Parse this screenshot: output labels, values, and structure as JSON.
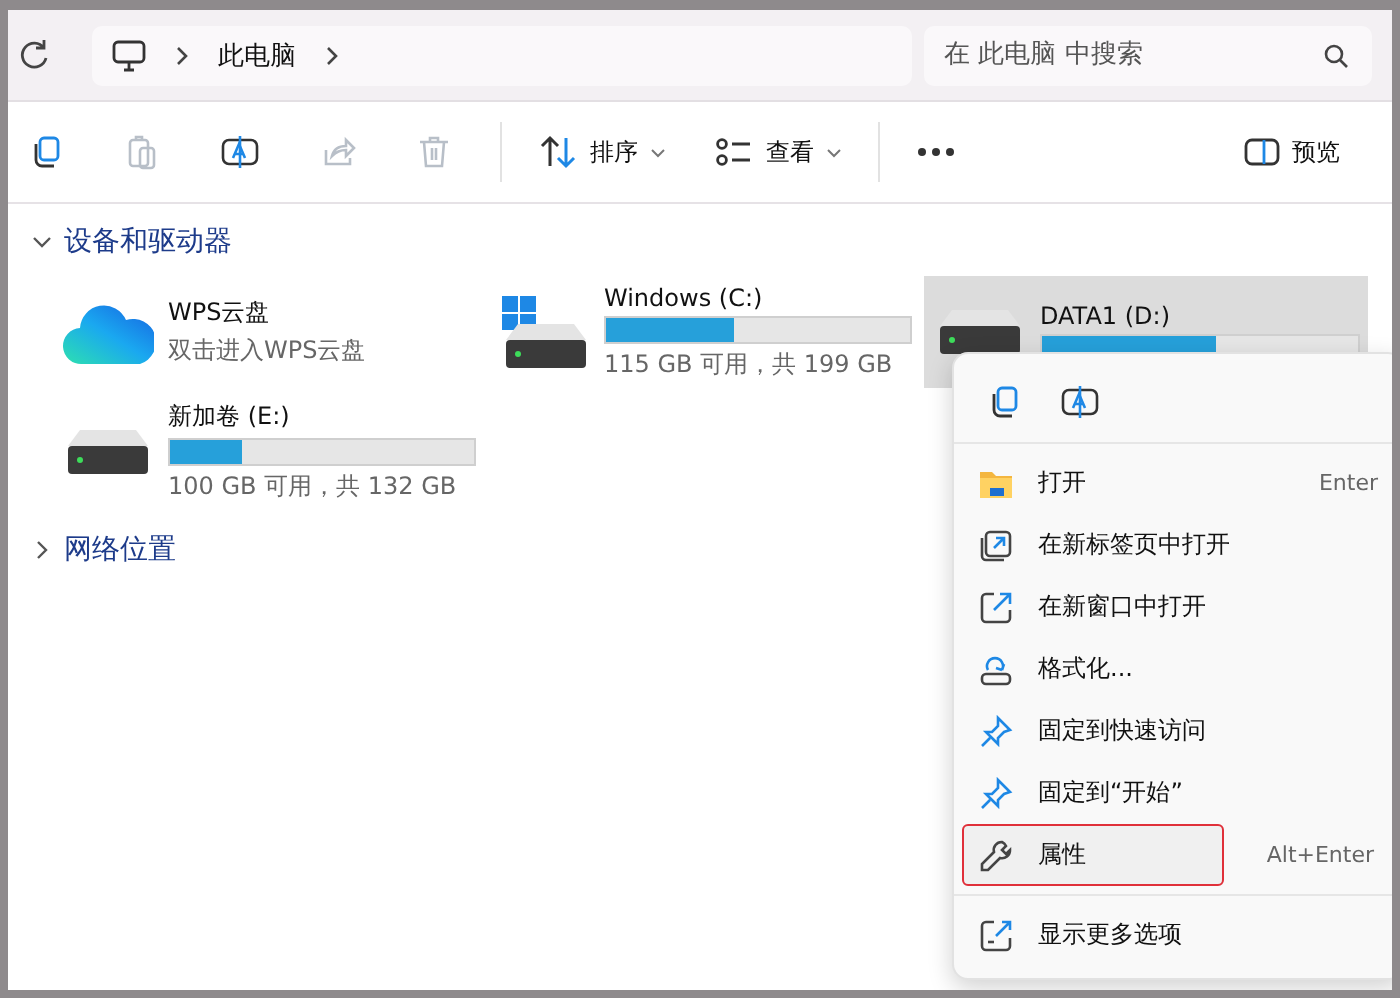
{
  "address_bar": {
    "crumbs": [
      "此电脑"
    ],
    "search": {
      "placeholder": "在 此电脑 中搜索"
    }
  },
  "toolbar": {
    "items": [
      {
        "kind": "icon",
        "disabled": false
      },
      {
        "kind": "icon",
        "disabled": true
      },
      {
        "kind": "icon",
        "disabled": false
      },
      {
        "kind": "icon",
        "disabled": true
      },
      {
        "kind": "icon",
        "disabled": true
      },
      {
        "kind": "separator"
      },
      {
        "kind": "dropdown",
        "label": "排序",
        "disabled": false
      },
      {
        "kind": "dropdown",
        "label": "查看",
        "disabled": false
      },
      {
        "kind": "separator"
      },
      {
        "kind": "icon",
        "disabled": false
      },
      {
        "kind": "spacer"
      },
      {
        "kind": "labeled",
        "label": "预览",
        "disabled": false
      }
    ]
  },
  "sections": [
    {
      "title": "设备和驱动器",
      "expanded": true,
      "items": [
        {
          "kind": "cloud",
          "name": "WPS云盘",
          "subtitle": "双击进入WPS云盘",
          "selected": false
        },
        {
          "kind": "system",
          "name": "Windows (C:)",
          "level": 0.42,
          "subtitle": "115 GB 可用，共 199 GB",
          "selected": false
        },
        {
          "kind": "drive",
          "name": "DATA1 (D:)",
          "level": 0.55,
          "selected": true
        },
        {
          "kind": "drive",
          "name": "新加卷 (E:)",
          "level": 0.24,
          "subtitle": "100 GB 可用，共 132 GB",
          "selected": false
        }
      ]
    },
    {
      "title": "网络位置",
      "expanded": false
    }
  ],
  "context_menu": {
    "items": [
      {
        "label": "打开",
        "shortcut": "Enter",
        "highlighted": false
      },
      {
        "label": "在新标签页中打开",
        "highlighted": false
      },
      {
        "label": "在新窗口中打开",
        "highlighted": false
      },
      {
        "label": "格式化...",
        "highlighted": false
      },
      {
        "label": "固定到快速访问",
        "highlighted": false
      },
      {
        "label": "固定到“开始”",
        "highlighted": false
      },
      {
        "label": "属性",
        "shortcut": "Alt+Enter",
        "highlighted": true
      },
      {
        "label": "显示更多选项",
        "highlighted": false
      }
    ]
  }
}
